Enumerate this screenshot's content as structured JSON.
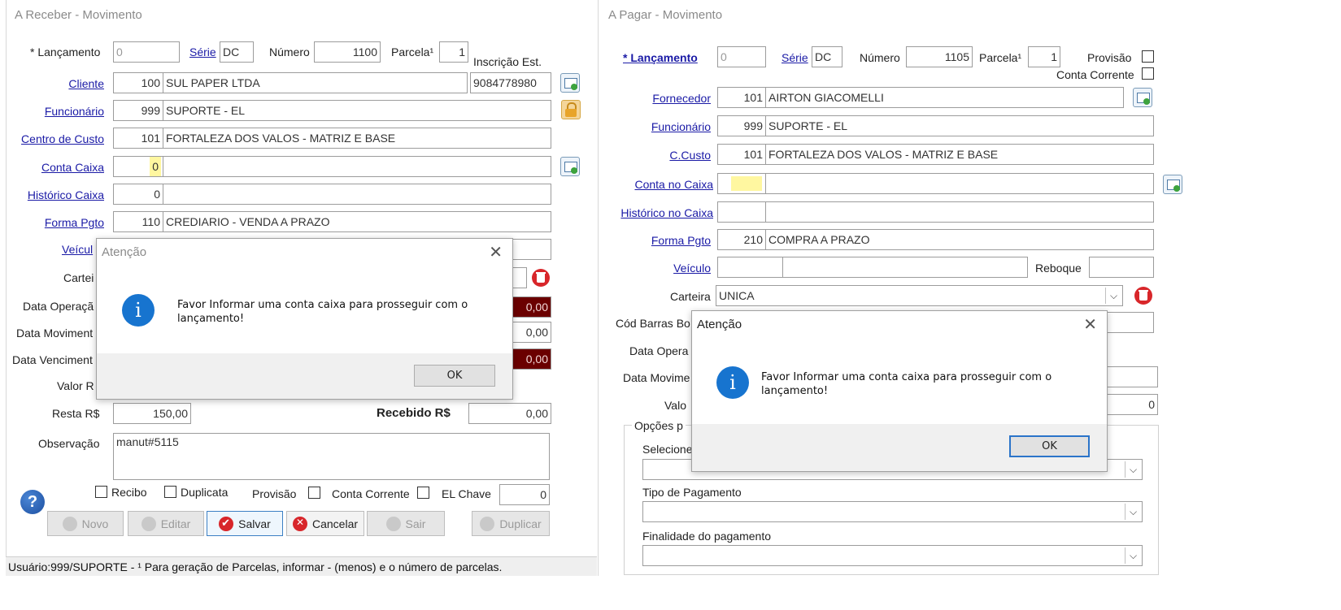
{
  "left": {
    "title": "A Receber - Movimento",
    "lancamento_label": "* Lançamento",
    "lancamento_value": "0",
    "serie_label": "Série",
    "serie_value": "DC",
    "numero_label": "Número",
    "numero_value": "1100",
    "parcela_label": "Parcela¹",
    "parcela_value": "1",
    "inscricao_label": "Inscrição Est.",
    "inscricao_value": "9084778980",
    "cliente_label": "Cliente",
    "cliente_code": "100",
    "cliente_name": "SUL PAPER LTDA",
    "funcionario_label": "Funcionário",
    "funcionario_code": "999",
    "funcionario_name": "SUPORTE - EL",
    "centro_label": "Centro de Custo",
    "centro_code": "101",
    "centro_name": "FORTALEZA DOS VALOS - MATRIZ E BASE",
    "conta_caixa_label": "Conta Caixa",
    "conta_caixa_code": "0",
    "historico_label": "Histórico Caixa",
    "historico_code": "0",
    "forma_label": "Forma Pgto",
    "forma_code": "110",
    "forma_name": "CREDIARIO - VENDA A PRAZO",
    "veiculo_label": "Veícul",
    "carteira_label": "Cartei",
    "data_operacao_label": "Data Operaçã",
    "data_operacao_value": "0,00",
    "data_movimento_label": "Data Moviment",
    "data_movimento_value": "0,00",
    "data_vencimento_label": "Data Venciment",
    "data_vencimento_value": "0,00",
    "valor_label": "Valor R",
    "resta_label": "Resta R$",
    "resta_value": "150,00",
    "recebido_label": "Recebido R$",
    "recebido_value": "0,00",
    "observacao_label": "Observação",
    "observacao_value": "manut#5115",
    "recibo_label": "Recibo",
    "duplicata_label": "Duplicata",
    "provisao_label": "Provisão",
    "conta_corrente_label": "Conta Corrente",
    "el_chave_label": "EL Chave",
    "el_chave_value": "0",
    "buttons": {
      "novo": "Novo",
      "editar": "Editar",
      "salvar": "Salvar",
      "cancelar": "Cancelar",
      "sair": "Sair",
      "duplicar": "Duplicar"
    },
    "status": "Usuário:999/SUPORTE - ¹ Para geração de Parcelas, informar - (menos) e o número de parcelas.",
    "dialog": {
      "title": "Atenção",
      "message_line1": "Favor Informar uma conta caixa para prosseguir com o",
      "message_line2": "lançamento!",
      "ok": "OK"
    }
  },
  "right": {
    "title": "A Pagar - Movimento",
    "lancamento_label": "* Lançamento",
    "lancamento_value": "0",
    "serie_label": "Série",
    "serie_value": "DC",
    "numero_label": "Número",
    "numero_value": "1105",
    "parcela_label": "Parcela¹",
    "parcela_value": "1",
    "provisao_label": "Provisão",
    "conta_corrente_label": "Conta Corrente",
    "fornecedor_label": "Fornecedor",
    "fornecedor_code": "101",
    "fornecedor_name": "AIRTON GIACOMELLI",
    "funcionario_label": "Funcionário",
    "funcionario_code": "999",
    "funcionario_name": "SUPORTE - EL",
    "ccusto_label": "C.Custo",
    "ccusto_code": "101",
    "ccusto_name": "FORTALEZA DOS VALOS - MATRIZ E BASE",
    "conta_caixa_label": "Conta no Caixa",
    "historico_label": "Histórico no Caixa",
    "forma_label": "Forma Pgto",
    "forma_code": "210",
    "forma_name": "COMPRA A PRAZO",
    "veiculo_label": "Veículo",
    "reboque_label": "Reboque",
    "carteira_label": "Carteira",
    "carteira_value": "UNICA",
    "cod_barras_label": "Cód Barras Bo",
    "data_operacao_label": "Data Opera",
    "data_movimento_label": "Data Movime",
    "valor_label": "Valo",
    "valor_value": "0",
    "opcoes_label": "Opções p",
    "selecione_label": "Selecione",
    "tipo_pagamento_label": "Tipo de Pagamento",
    "finalidade_label": "Finalidade do pagamento",
    "dialog": {
      "title": "Atenção",
      "message_line1": "Favor Informar uma conta caixa para prosseguir com o",
      "message_line2": "lançamento!",
      "ok": "OK"
    }
  }
}
